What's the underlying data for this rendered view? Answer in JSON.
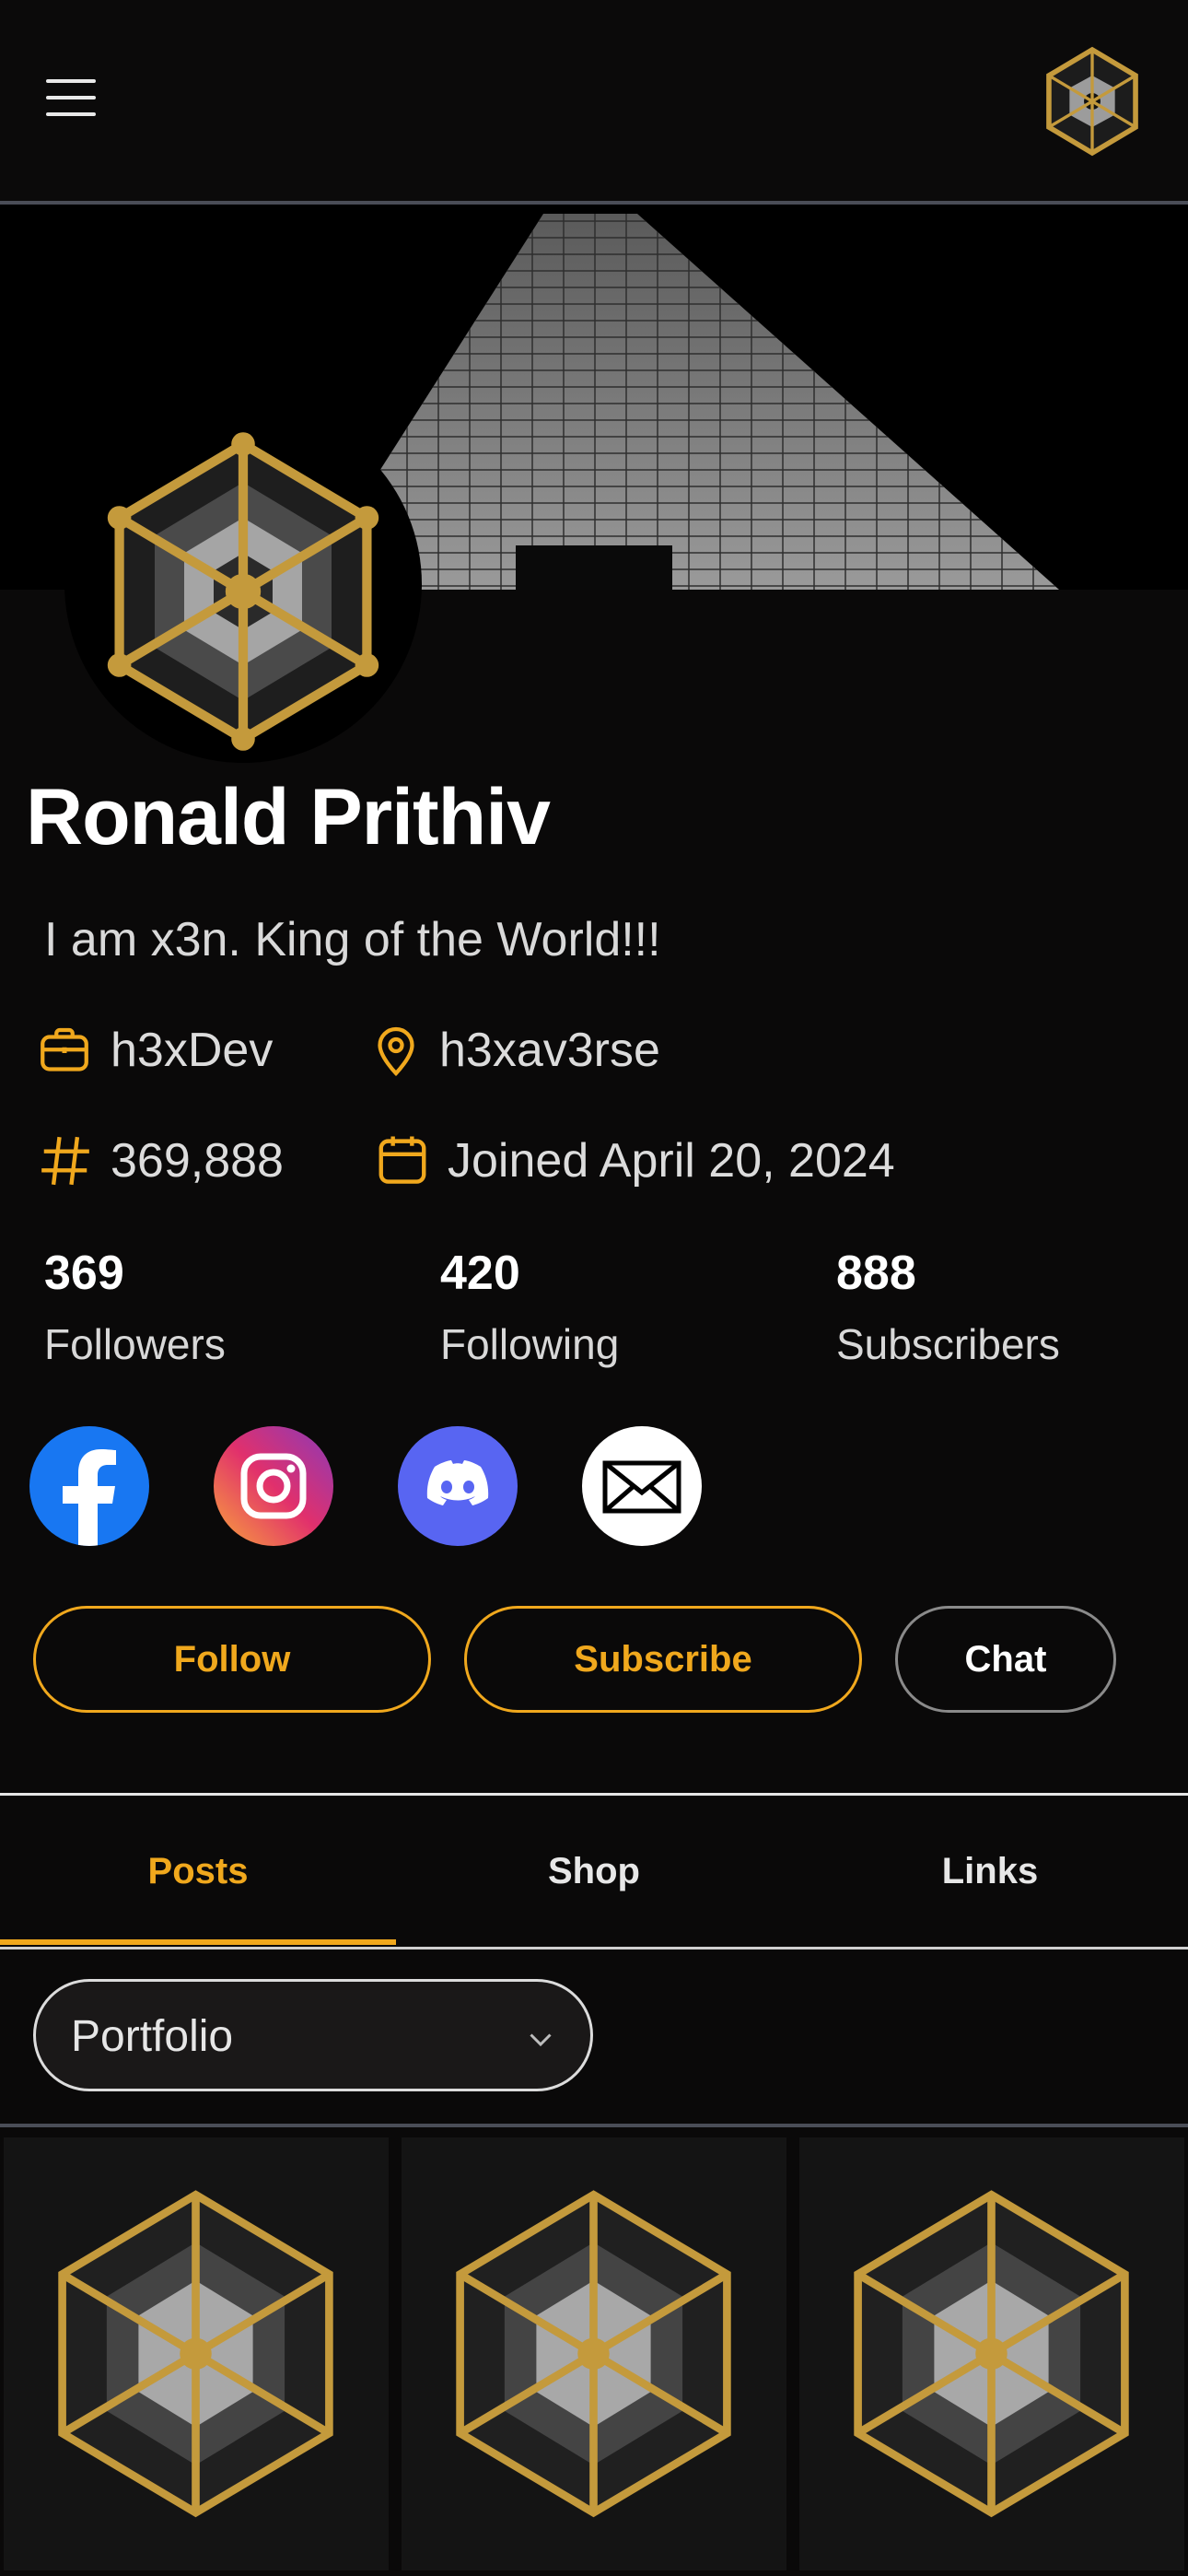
{
  "header": {
    "menu_icon": "hamburger-menu-icon",
    "logo_icon": "hexagon-cube-logo-icon"
  },
  "profile": {
    "name": "Ronald Prithiv",
    "bio": "I am x3n. King of the World!!!",
    "work": "h3xDev",
    "location": "h3xav3rse",
    "number": "369,888",
    "joined": "Joined April 20, 2024"
  },
  "stats": [
    {
      "value": "369",
      "label": "Followers"
    },
    {
      "value": "420",
      "label": "Following"
    },
    {
      "value": "888",
      "label": "Subscribers"
    }
  ],
  "social": [
    "facebook-icon",
    "instagram-icon",
    "discord-icon",
    "email-icon"
  ],
  "actions": {
    "follow": "Follow",
    "subscribe": "Subscribe",
    "chat": "Chat"
  },
  "tabs": [
    {
      "label": "Posts",
      "active": true
    },
    {
      "label": "Shop",
      "active": false
    },
    {
      "label": "Links",
      "active": false
    }
  ],
  "filter": {
    "selected": "Portfolio"
  },
  "colors": {
    "accent": "#f0a81d",
    "gold": "#c49a3c",
    "background": "#0a0909"
  }
}
